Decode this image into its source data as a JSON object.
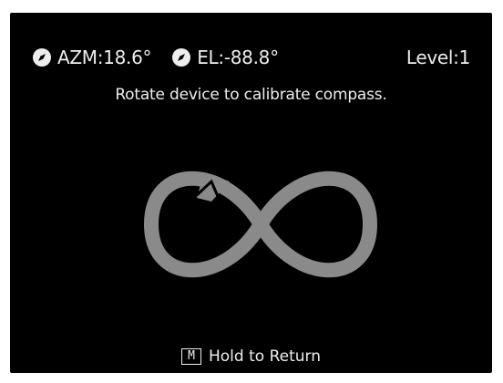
{
  "status": {
    "azimuth": {
      "label": "AZM:18.6°",
      "icon": "compass-icon"
    },
    "elevation": {
      "label": "EL:-88.8°",
      "icon": "compass-icon"
    },
    "level": "Level:1"
  },
  "instruction": "Rotate device to calibrate compass.",
  "graphic": {
    "icon": "figure-eight-rotation-icon",
    "color": "#8a8a8a"
  },
  "footer": {
    "key": "M",
    "label": "Hold to Return"
  },
  "colors": {
    "background": "#000000",
    "text": "#ededed"
  }
}
